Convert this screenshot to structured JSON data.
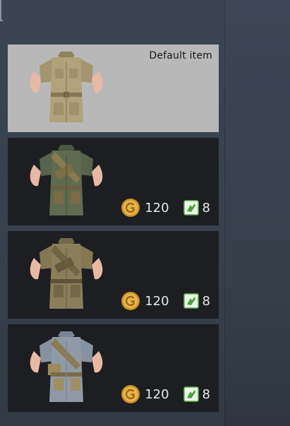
{
  "default_card": {
    "label": "Default item"
  },
  "items": [
    {
      "uniform_color": "#5e6b4f",
      "gold_price": "120",
      "ticket_price": "8"
    },
    {
      "uniform_color": "#8b7f5b",
      "gold_price": "120",
      "ticket_price": "8"
    },
    {
      "uniform_color": "#8f9aa6",
      "gold_price": "120",
      "ticket_price": "8"
    }
  ],
  "icons": {
    "currency": "gold-coin-icon",
    "secondary_currency": "ticket-icon"
  },
  "colors": {
    "default_card_bg": "#b8b8b8",
    "item_card_bg": "#1c1e21",
    "gold": "#d6a23a",
    "ticket_green": "#5cb84a"
  }
}
